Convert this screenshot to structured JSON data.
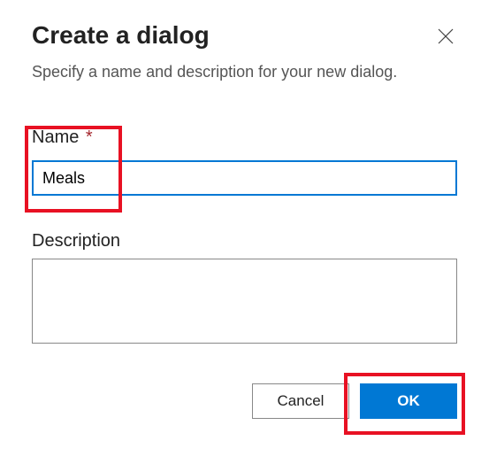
{
  "dialog": {
    "title": "Create a dialog",
    "subtitle": "Specify a name and description for your new dialog."
  },
  "fields": {
    "name": {
      "label": "Name",
      "required_marker": "*",
      "value": "Meals"
    },
    "description": {
      "label": "Description",
      "value": ""
    }
  },
  "buttons": {
    "cancel": "Cancel",
    "ok": "OK"
  }
}
